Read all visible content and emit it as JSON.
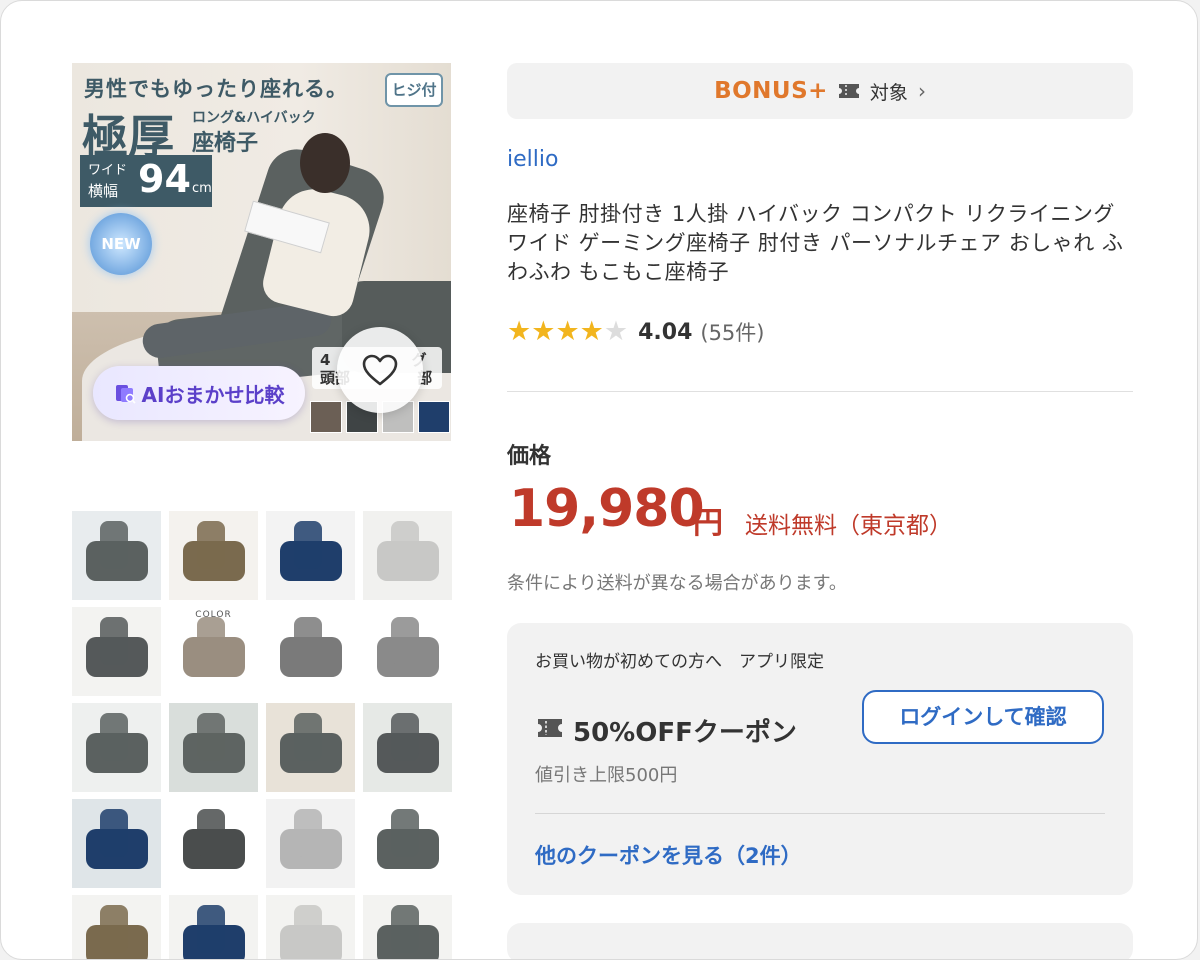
{
  "hero": {
    "headline_top": "男性でもゆったり座れる。",
    "headline_big": "極厚",
    "headline_side_small": "ロング&ハイバック",
    "headline_side_big": "座椅子",
    "badge": "ヒジ付",
    "wide_label_1": "ワイド",
    "wide_label_2": "横幅",
    "wide_value": "94",
    "wide_unit": "cm",
    "new_badge": "NEW",
    "recline_text_1": "4",
    "recline_text_2": "グ",
    "recline_text_3": "頭部",
    "recline_text_4": "部",
    "swatch_colors": [
      "#6b5f55",
      "#3f4445",
      "#bfbfbe",
      "#1f3e6b"
    ],
    "ai_compare_label": "AIおまかせ比較",
    "favorite_icon": "heart-outline-icon"
  },
  "thumbnails": [
    {
      "bg": "#e8ecee",
      "color": "#5b6160",
      "selected": true
    },
    {
      "bg": "#f4f2ee",
      "color": "#7a6a4e"
    },
    {
      "bg": "#f3f3f3",
      "color": "#1f3e6b"
    },
    {
      "bg": "#f1f1ef",
      "color": "#c8c8c6"
    },
    {
      "bg": "#f3f3f1",
      "color": "#55595a"
    },
    {
      "bg": "#ffffff",
      "color": "#9a8e80",
      "caption": "COLOR"
    },
    {
      "bg": "#ffffff",
      "color": "#7a7a7a"
    },
    {
      "bg": "#ffffff",
      "color": "#8a8a8a"
    },
    {
      "bg": "#eef0ef",
      "color": "#5b6160"
    },
    {
      "bg": "#d9dedb",
      "color": "#5e6462"
    },
    {
      "bg": "#e8e2d8",
      "color": "#5b6160"
    },
    {
      "bg": "#e6e9e6",
      "color": "#55595a"
    },
    {
      "bg": "#dfe5e8",
      "color": "#1f3e6b"
    },
    {
      "bg": "#ffffff",
      "color": "#4a4d4d"
    },
    {
      "bg": "#f2f2f2",
      "color": "#b5b5b5"
    },
    {
      "bg": "#ffffff",
      "color": "#5b6160"
    },
    {
      "bg": "#f3f3f1",
      "color": "#7a6a4e"
    },
    {
      "bg": "#f3f3f1",
      "color": "#1f3e6b"
    },
    {
      "bg": "#f3f3f1",
      "color": "#c8c8c6"
    },
    {
      "bg": "#f3f3f1",
      "color": "#5b6160"
    }
  ],
  "bonus": {
    "logo_text": "BONUS+",
    "label": "対象",
    "chevron": "›",
    "logo_color": "#e0782c"
  },
  "product": {
    "brand": "iellio",
    "title": "座椅子 肘掛付き 1人掛 ハイバック コンパクト リクライニング ワイド ゲーミング座椅子 肘付き パーソナルチェア おしゃれ ふわふわ もこもこ座椅子",
    "rating_value": "4.04",
    "rating_count": "(55件)",
    "rating_stars_filled": 4,
    "rating_stars_total": 5,
    "star_color": "#f2b51e",
    "star_empty_color": "#dddddd"
  },
  "price": {
    "label": "価格",
    "amount": "19,980",
    "unit": "円",
    "shipping": "送料無料（東京都）",
    "note": "条件により送料が異なる場合があります。",
    "color": "#bf3a2a"
  },
  "coupon": {
    "condition": "お買い物が初めての方へ　アプリ限定",
    "title": "50%OFFクーポン",
    "limit": "値引き上限500円",
    "login_button": "ログインして確認",
    "more_link": "他のクーポンを見る（2件）",
    "accent_color": "#2f6bc4"
  }
}
